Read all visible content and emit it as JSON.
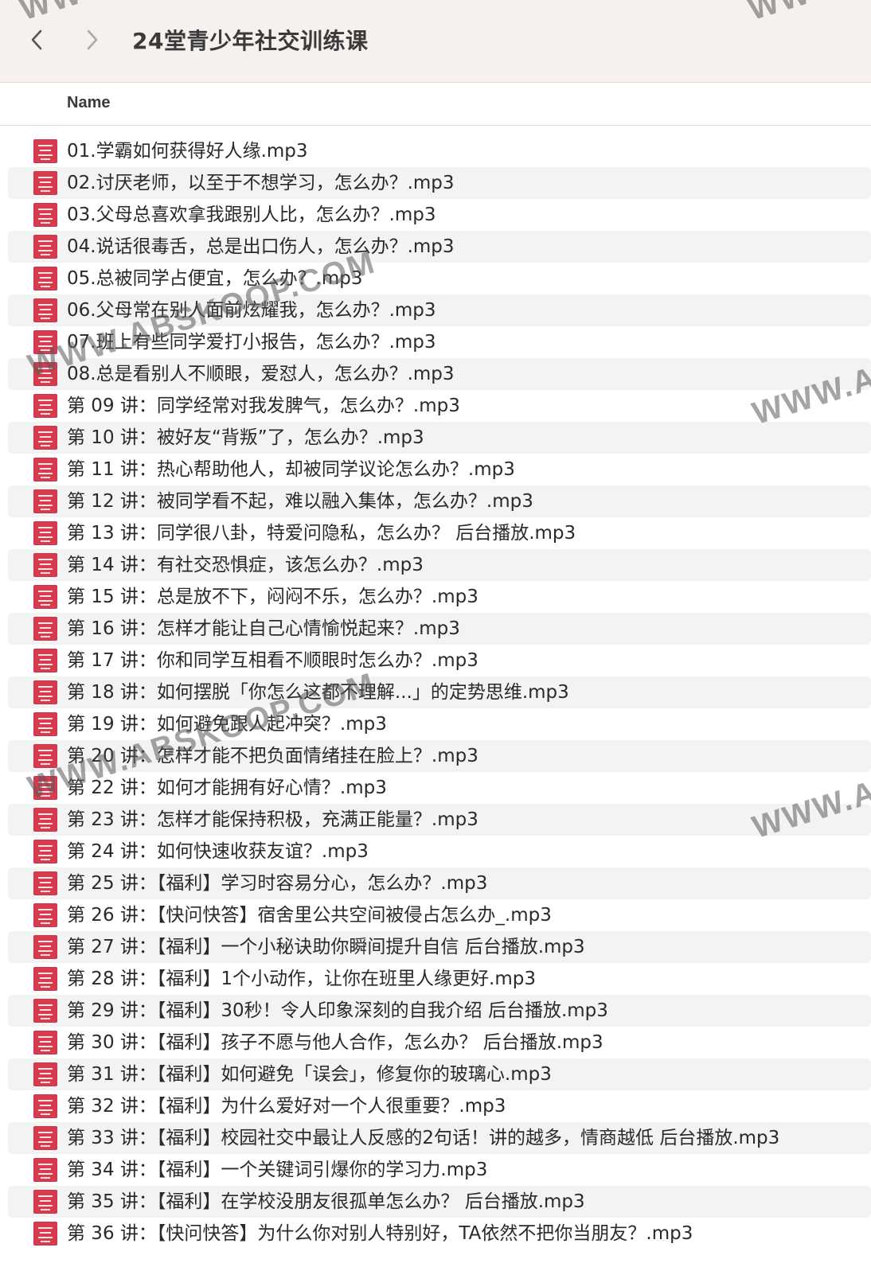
{
  "window": {
    "title": "24堂青少年社交训练课",
    "back_icon": "chevron-left-icon",
    "forward_icon": "chevron-right-icon"
  },
  "columns": {
    "name_label": "Name"
  },
  "file_icon": "audio-file-icon",
  "files": [
    "01.学霸如何获得好人缘.mp3",
    "02.讨厌老师，以至于不想学习，怎么办？.mp3",
    "03.父母总喜欢拿我跟别人比，怎么办？.mp3",
    "04.说话很毒舌，总是出口伤人，怎么办？.mp3",
    "05.总被同学占便宜，怎么办？.mp3",
    "06.父母常在别人面前炫耀我，怎么办？.mp3",
    "07.班上有些同学爱打小报告，怎么办？.mp3",
    "08.总是看别人不顺眼，爱怼人，怎么办？.mp3",
    "第 09 讲：同学经常对我发脾气，怎么办？.mp3",
    "第 10 讲：被好友“背叛”了，怎么办？.mp3",
    "第 11 讲：热心帮助他人，却被同学议论怎么办？.mp3",
    "第 12 讲：被同学看不起，难以融入集体，怎么办？.mp3",
    "第 13 讲：同学很八卦，特爱问隐私，怎么办？ 后台播放.mp3",
    "第 14 讲：有社交恐惧症，该怎么办？.mp3",
    "第 15 讲：总是放不下，闷闷不乐，怎么办？.mp3",
    "第 16 讲：怎样才能让自己心情愉悦起来？.mp3",
    "第 17 讲：你和同学互相看不顺眼时怎么办？.mp3",
    "第 18 讲：如何摆脱「你怎么这都不理解...」的定势思维.mp3",
    "第 19 讲：如何避免跟人起冲突？.mp3",
    "第 20 讲：怎样才能不把负面情绪挂在脸上？.mp3",
    "第 22 讲：如何才能拥有好心情？.mp3",
    "第 23 讲：怎样才能保持积极，充满正能量？.mp3",
    "第 24 讲：如何快速收获友谊？.mp3",
    "第 25 讲：【福利】学习时容易分心，怎么办？.mp3",
    "第 26 讲：【快问快答】宿舍里公共空间被侵占怎么办_.mp3",
    "第 27 讲：【福利】一个小秘诀助你瞬间提升自信 后台播放.mp3",
    "第 28 讲：【福利】1个小动作，让你在班里人缘更好.mp3",
    "第 29 讲：【福利】30秒！令人印象深刻的自我介绍 后台播放.mp3",
    "第 30 讲：【福利】孩子不愿与他人合作，怎么办？ 后台播放.mp3",
    "第 31 讲：【福利】如何避免「误会」，修复你的玻璃心.mp3",
    "第 32 讲：【福利】为什么爱好对一个人很重要？.mp3",
    "第 33 讲：【福利】校园社交中最让人反感的2句话！讲的越多，情商越低 后台播放.mp3",
    "第 34 讲：【福利】一个关键词引爆你的学习力.mp3",
    "第 35 讲：【福利】在学校没朋友很孤单怎么办？ 后台播放.mp3",
    "第 36 讲：【快问快答】为什么你对别人特别好，TA依然不把你当朋友？.mp3"
  ],
  "watermark": {
    "text": "WWW.ABSKOOP.COM",
    "partial_text": "WWW.A",
    "top_partial_text": "WW"
  },
  "colors": {
    "toolbar_bg": "#f6f1ee",
    "row_stripe": "#f3f3f3",
    "file_icon": "#d83a4e"
  }
}
